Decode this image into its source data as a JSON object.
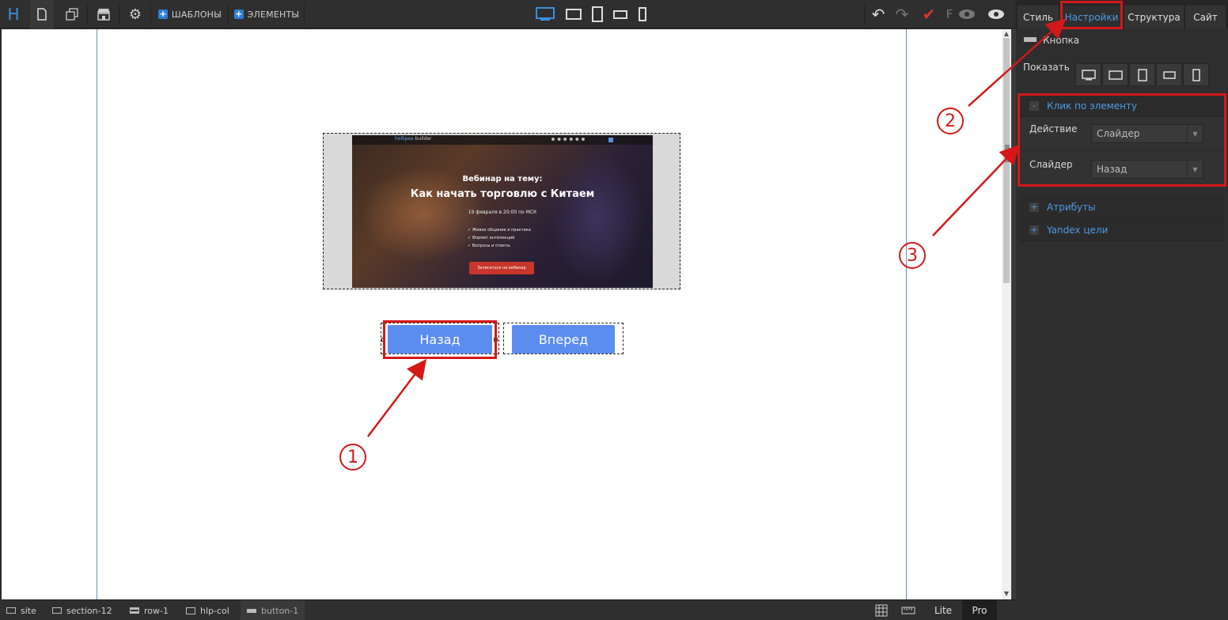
{
  "toolbar": {
    "logo": "H",
    "templates_label": "ШАБЛОНЫ",
    "elements_label": "ЭЛЕМЕНТЫ",
    "f_label": "F"
  },
  "panel": {
    "tabs": [
      {
        "label": "Стиль"
      },
      {
        "label": "Настройки"
      },
      {
        "label": "Структура"
      },
      {
        "label": "Сайт"
      }
    ],
    "element_title": "Кнопка",
    "show_label": "Показать",
    "click_section": {
      "title": "Клик по элементу",
      "toggle": "-",
      "action_label": "Действие",
      "action_value": "Слайдер",
      "slider_label": "Слайдер",
      "slider_value": "Назад"
    },
    "attributes_section": {
      "title": "Атрибуты",
      "toggle": "+"
    },
    "yandex_section": {
      "title": "Yandex цели",
      "toggle": "+"
    }
  },
  "slide": {
    "brand_a": "hollipee",
    "brand_b": "builder",
    "kicker": "Вебинар на тему:",
    "title": "Как начать торговлю с Китаем",
    "date": "19 февраля в 20:00 по МСК",
    "features": [
      "Живое общение и практика",
      "Формат антилекций",
      "Вопросы и ответы"
    ],
    "cta": "Записаться на вебинар"
  },
  "buttons": {
    "back_label": "Назад",
    "forward_label": "Вперед"
  },
  "annotations": {
    "one": "1",
    "two": "2",
    "three": "3"
  },
  "statusbar": {
    "crumbs": [
      "site",
      "section-12",
      "row-1",
      "hlp-col",
      "button-1"
    ],
    "lite": "Lite",
    "pro": "Pro"
  },
  "colors": {
    "accent": "#4c9ce8",
    "button": "#5b8def",
    "annotation": "#d41818"
  }
}
